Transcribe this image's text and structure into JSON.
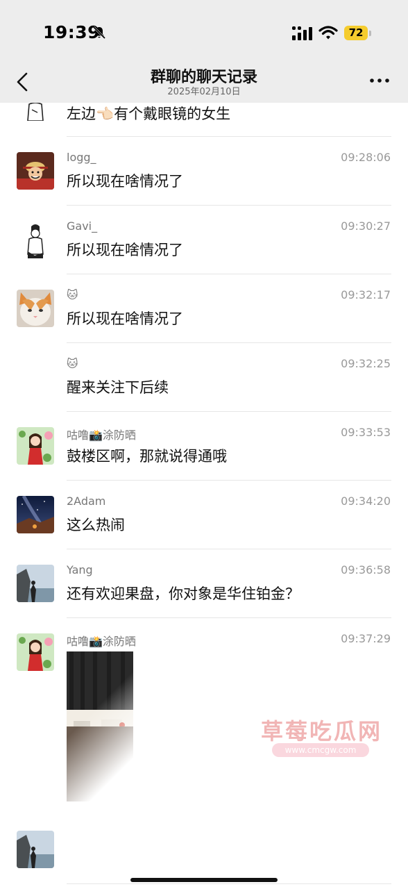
{
  "status_bar": {
    "time": "19:39",
    "battery": "72"
  },
  "nav": {
    "title": "群聊的聊天记录",
    "subtitle": "2025年02月10日"
  },
  "messages": [
    {
      "text": "左边👈🏻有个戴眼镜的女生"
    },
    {
      "sender": "logg_",
      "time": "09:28:06",
      "text": "所以现在啥情况了"
    },
    {
      "sender": "Gavi_",
      "time": "09:30:27",
      "text": "所以现在啥情况了"
    },
    {
      "sender": "🐱",
      "time": "09:32:17",
      "text": "所以现在啥情况了"
    },
    {
      "sender": "🐱",
      "time": "09:32:25",
      "text": "醒来关注下后续"
    },
    {
      "sender": "咕噜📸涂防晒",
      "time": "09:33:53",
      "text": "鼓楼区啊，那就说得通哦"
    },
    {
      "sender": "2Adam",
      "time": "09:34:20",
      "text": "这么热闹"
    },
    {
      "sender": "Yang",
      "time": "09:36:58",
      "text": "还有欢迎果盘，你对象是华住铂金？"
    },
    {
      "sender": "咕噜📸涂防晒",
      "time": "09:37:29"
    }
  ],
  "watermark": {
    "brand": "草莓吃瓜网",
    "url": "www.cmcgw.com"
  },
  "colors": {
    "bar_bg": "#ededed",
    "battery": "#f5cc2e",
    "divider": "#e6e6e6"
  }
}
